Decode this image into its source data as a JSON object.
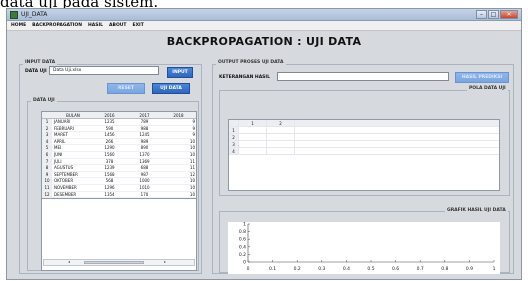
{
  "doc_caption": "data uji pada sistem.",
  "window": {
    "title": "UJI_DATA",
    "controls": {
      "minimize": "–",
      "maximize": "□",
      "close": "✕"
    }
  },
  "menu": [
    "HOME",
    "BACKPROPAGATION",
    "HASIL",
    "ABOUT",
    "EXIT"
  ],
  "main_title": "BACKPROPAGATION : UJI DATA",
  "input_panel": {
    "title": "INPUT DATA",
    "data_label": "DATA UJI",
    "file_value": "Data Uji.xlsx",
    "input_button": "INPUT",
    "reset_button": "RESET",
    "uji_button": "UJI DATA",
    "table_group_title": "DATA UJI",
    "columns": [
      "",
      "BULAN",
      "2016",
      "2017",
      "2018"
    ],
    "rows": [
      [
        "1",
        "JANUARI",
        "1235",
        "789",
        "9"
      ],
      [
        "2",
        "FEBRUARI",
        "590",
        "988",
        "9"
      ],
      [
        "3",
        "MARET",
        "1456",
        "1245",
        "9"
      ],
      [
        "4",
        "APRIL",
        "266",
        "989",
        "10"
      ],
      [
        "5",
        "MEI",
        "1290",
        "890",
        "10"
      ],
      [
        "6",
        "JUNI",
        "1560",
        "1370",
        "10"
      ],
      [
        "7",
        "JULI",
        "378",
        "1369",
        "11"
      ],
      [
        "8",
        "AGUSTUS",
        "1239",
        "688",
        "11"
      ],
      [
        "9",
        "SEPTEMBER",
        "1568",
        "987",
        "12"
      ],
      [
        "10",
        "OKTOBER",
        "568",
        "1000",
        "10"
      ],
      [
        "11",
        "NOVEMBER",
        "1296",
        "1010",
        "10"
      ],
      [
        "12",
        "DESEMBER",
        "1354",
        "170",
        "10"
      ]
    ]
  },
  "output_panel": {
    "title": "OUTPUT PROSES UJI DATA",
    "keterangan_label": "KETERANGAN HASIL",
    "keterangan_value": "",
    "prediksi_button": "HASIL PREDIKSI",
    "pola_title": "POLA DATA UJI",
    "pola_columns": [
      "",
      "1",
      "2"
    ],
    "pola_rows": [
      "1",
      "2",
      "3",
      "4"
    ],
    "grafik_title": "GRAFIK HASIL UJI DATA"
  },
  "chart_data": {
    "type": "line",
    "title": "",
    "xlabel": "",
    "ylabel": "",
    "x_ticks": [
      "0",
      "0.1",
      "0.2",
      "0.3",
      "0.4",
      "0.5",
      "0.6",
      "0.7",
      "0.8",
      "0.9",
      "1"
    ],
    "y_ticks": [
      "0",
      "0.2",
      "0.4",
      "0.6",
      "0.8",
      "1"
    ],
    "xlim": [
      0,
      1
    ],
    "ylim": [
      0,
      1
    ],
    "series": []
  }
}
